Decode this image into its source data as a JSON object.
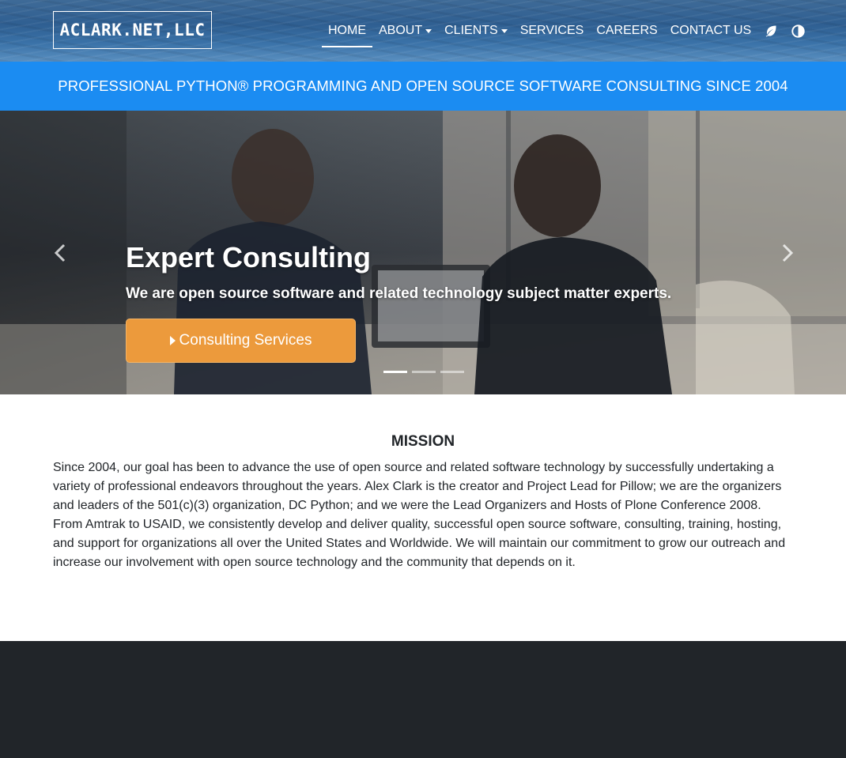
{
  "brand": {
    "name": "ACLARK.NET,LLC"
  },
  "nav": {
    "items": [
      {
        "label": "HOME",
        "active": true,
        "dropdown": false
      },
      {
        "label": "ABOUT",
        "active": false,
        "dropdown": true
      },
      {
        "label": "CLIENTS",
        "active": false,
        "dropdown": true
      },
      {
        "label": "SERVICES",
        "active": false,
        "dropdown": false
      },
      {
        "label": "CAREERS",
        "active": false,
        "dropdown": false
      },
      {
        "label": "CONTACT US",
        "active": false,
        "dropdown": false
      }
    ],
    "icons": [
      "leaf-icon",
      "contrast-icon"
    ]
  },
  "banner": {
    "text": "PROFESSIONAL PYTHON® PROGRAMMING AND OPEN SOURCE SOFTWARE CONSULTING SINCE 2004"
  },
  "hero": {
    "title": "Expert Consulting",
    "subtitle": "We are open source software and related technology subject matter experts.",
    "button_label": "Consulting Services",
    "slide_count": 3,
    "active_slide": 1
  },
  "mission": {
    "title": "MISSION",
    "text": "Since 2004, our goal has been to advance the use of open source and related software technology by successfully undertaking a variety of professional endeavors throughout the years. Alex Clark is the creator and Project Lead for Pillow; we are the organizers and leaders of the 501(c)(3) organization, DC Python; and we were the Lead Organizers and Hosts of Plone Conference 2008. From Amtrak to USAID, we consistently develop and deliver quality, successful open source software, consulting, training, hosting, and support for organizations all over the United States and Worldwide. We will maintain our commitment to grow our outreach and increase our involvement with open source technology and the community that depends on it."
  },
  "colors": {
    "banner": "#1b8cf2",
    "button": "#ec9a3c",
    "footer": "#212529"
  }
}
